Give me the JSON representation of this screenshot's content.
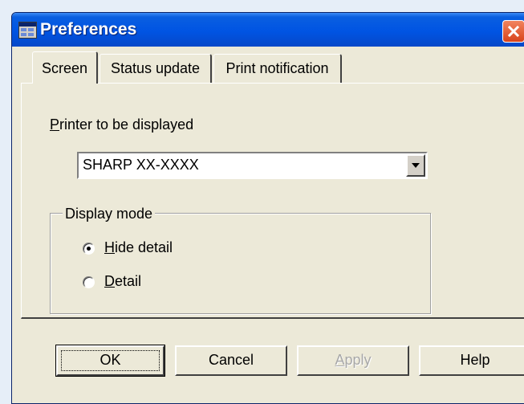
{
  "window": {
    "title": "Preferences"
  },
  "tabs": [
    {
      "label": "Screen",
      "active": true
    },
    {
      "label": "Status update",
      "active": false
    },
    {
      "label": "Print notification",
      "active": false
    }
  ],
  "screen_tab": {
    "printer_label": {
      "hotkey": "P",
      "rest": "rinter to be displayed"
    },
    "printer_select": {
      "value": "SHARP XX-XXXX"
    },
    "display_mode": {
      "legend": "Display mode",
      "options": [
        {
          "hotkey": "H",
          "rest": "ide detail",
          "selected": true
        },
        {
          "hotkey": "D",
          "rest": "etail",
          "selected": false
        }
      ]
    }
  },
  "buttons": {
    "ok": "OK",
    "cancel": "Cancel",
    "apply": {
      "hotkey": "A",
      "rest": "pply",
      "enabled": false
    },
    "help": "Help"
  },
  "colors": {
    "titlebar": "#0054e3",
    "dialog_bg": "#ece9d8",
    "close_button": "#d8431b",
    "desktop_bg": "#e6eef8"
  }
}
